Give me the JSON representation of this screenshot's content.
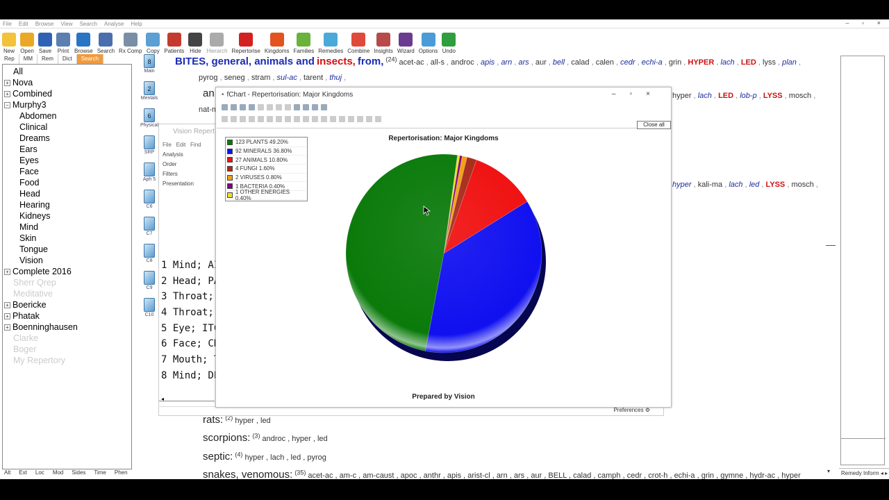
{
  "menu": [
    "File",
    "Edit",
    "Browse",
    "View",
    "Search",
    "Analyse",
    "Help"
  ],
  "toolbar": [
    {
      "label": "New",
      "icon": "new-icon",
      "color": "#f2c23a"
    },
    {
      "label": "Open",
      "icon": "folder-icon",
      "color": "#e9a826"
    },
    {
      "label": "Save",
      "icon": "save-icon",
      "color": "#2f62b5"
    },
    {
      "label": "Print",
      "icon": "print-icon",
      "color": "#5a7fb0"
    },
    {
      "label": "Browse",
      "icon": "book-icon",
      "color": "#2a74c4"
    },
    {
      "label": "Search",
      "icon": "magnifier-icon",
      "color": "#4b6fae"
    },
    {
      "label": "Rx Comp",
      "icon": "bottle-icon",
      "color": "#7a8fa5"
    },
    {
      "label": "Copy",
      "icon": "copy-icon",
      "color": "#5c9fd3"
    },
    {
      "label": "Patients",
      "icon": "calendar-icon",
      "color": "#c43a2e"
    },
    {
      "label": "Hide",
      "icon": "sphere-icon",
      "color": "#444"
    },
    {
      "label": "Hierarch",
      "icon": "hierarchy-icon",
      "color": "#aaa"
    },
    {
      "label": "Repertorise",
      "icon": "exclamation-icon",
      "color": "#d32020"
    },
    {
      "label": "Kingdoms",
      "icon": "pie-icon",
      "color": "#e2531f"
    },
    {
      "label": "Families",
      "icon": "families-icon",
      "color": "#6ab23b"
    },
    {
      "label": "Remedies",
      "icon": "remedies-icon",
      "color": "#4aa9d8"
    },
    {
      "label": "Combine",
      "icon": "combine-icon",
      "color": "#e04a3a"
    },
    {
      "label": "Insights",
      "icon": "insights-icon",
      "color": "#b94a4a"
    },
    {
      "label": "Wizard",
      "icon": "wizard-icon",
      "color": "#6b3b8f"
    },
    {
      "label": "Options",
      "icon": "options-icon",
      "color": "#4a9bd8"
    },
    {
      "label": "Undo",
      "icon": "undo-icon",
      "color": "#2e9e3e"
    }
  ],
  "left_tabs": [
    "Rep",
    "MM",
    "Rem",
    "Dict",
    "Search"
  ],
  "tree": [
    {
      "label": "All",
      "level": 0,
      "exp": "",
      "dim": false
    },
    {
      "label": "Nova",
      "level": 0,
      "exp": "+",
      "dim": false
    },
    {
      "label": "Combined",
      "level": 0,
      "exp": "+",
      "dim": false
    },
    {
      "label": "Murphy3",
      "level": 0,
      "exp": "−",
      "dim": false
    },
    {
      "label": "Abdomen",
      "level": 1,
      "exp": "",
      "dim": false
    },
    {
      "label": "Clinical",
      "level": 1,
      "exp": "",
      "dim": false
    },
    {
      "label": "Dreams",
      "level": 1,
      "exp": "",
      "dim": false
    },
    {
      "label": "Ears",
      "level": 1,
      "exp": "",
      "dim": false
    },
    {
      "label": "Eyes",
      "level": 1,
      "exp": "",
      "dim": false
    },
    {
      "label": "Face",
      "level": 1,
      "exp": "",
      "dim": false
    },
    {
      "label": "Food",
      "level": 1,
      "exp": "",
      "dim": false
    },
    {
      "label": "Head",
      "level": 1,
      "exp": "",
      "dim": false
    },
    {
      "label": "Hearing",
      "level": 1,
      "exp": "",
      "dim": false
    },
    {
      "label": "Kidneys",
      "level": 1,
      "exp": "",
      "dim": false
    },
    {
      "label": "Mind",
      "level": 1,
      "exp": "",
      "dim": false
    },
    {
      "label": "Skin",
      "level": 1,
      "exp": "",
      "dim": false
    },
    {
      "label": "Tongue",
      "level": 1,
      "exp": "",
      "dim": false
    },
    {
      "label": "Vision",
      "level": 1,
      "exp": "",
      "dim": false
    },
    {
      "label": "Complete 2016",
      "level": 0,
      "exp": "+",
      "dim": false
    },
    {
      "label": "Sherr Qrep",
      "level": 0,
      "exp": "",
      "dim": true
    },
    {
      "label": "Meditative",
      "level": 0,
      "exp": "",
      "dim": true
    },
    {
      "label": "Boericke",
      "level": 0,
      "exp": "+",
      "dim": false
    },
    {
      "label": "Phatak",
      "level": 0,
      "exp": "+",
      "dim": false
    },
    {
      "label": "Boenninghausen",
      "level": 0,
      "exp": "+",
      "dim": false
    },
    {
      "label": "Clarke",
      "level": 0,
      "exp": "",
      "dim": true
    },
    {
      "label": "Boger",
      "level": 0,
      "exp": "",
      "dim": true
    },
    {
      "label": "My Repertory",
      "level": 0,
      "exp": "",
      "dim": true
    }
  ],
  "bottom_tabs": [
    "Alt",
    "Ext",
    "Loc",
    "Mod",
    "Sides",
    "Time",
    "Phen"
  ],
  "chapters": [
    {
      "num": "8",
      "label": "Main"
    },
    {
      "num": "2",
      "label": "Mentals"
    },
    {
      "num": "6",
      "label": "Physical"
    },
    {
      "num": "",
      "label": "SRP"
    },
    {
      "num": "",
      "label": "Aph 5"
    },
    {
      "num": "",
      "label": "C6"
    },
    {
      "num": "",
      "label": "C7"
    },
    {
      "num": "",
      "label": "C8"
    },
    {
      "num": "",
      "label": "C9"
    },
    {
      "num": "",
      "label": "C10"
    }
  ],
  "main": {
    "title_a": "BITES, general, animals and",
    "title_b": "insects,",
    "title_c": "from,",
    "title_count": "(24)",
    "line1_remedies": [
      {
        "t": "acet-ac",
        "s": ""
      },
      {
        "t": "all-s",
        "s": ""
      },
      {
        "t": "androc",
        "s": ""
      },
      {
        "t": "apis",
        "s": "it"
      },
      {
        "t": "arn",
        "s": "it"
      },
      {
        "t": "ars",
        "s": "it"
      },
      {
        "t": "aur",
        "s": ""
      },
      {
        "t": "bell",
        "s": "it"
      },
      {
        "t": "calad",
        "s": ""
      },
      {
        "t": "calen",
        "s": ""
      },
      {
        "t": "cedr",
        "s": "it"
      },
      {
        "t": "echi-a",
        "s": "it"
      },
      {
        "t": "grin",
        "s": ""
      },
      {
        "t": "HYPER",
        "s": "bold"
      },
      {
        "t": "lach",
        "s": "it"
      },
      {
        "t": "LED",
        "s": "bold"
      },
      {
        "t": "lyss",
        "s": ""
      },
      {
        "t": "plan",
        "s": "it"
      }
    ],
    "line2_remedies": [
      {
        "t": "pyrog",
        "s": ""
      },
      {
        "t": "seneg",
        "s": ""
      },
      {
        "t": "stram",
        "s": ""
      },
      {
        "t": "sul-ac",
        "s": "it"
      },
      {
        "t": "tarent",
        "s": ""
      },
      {
        "t": "thuj",
        "s": "it"
      }
    ],
    "line3_start": "an",
    "line3_remedies": [
      {
        "t": "hyper",
        "s": ""
      },
      {
        "t": "lach",
        "s": "it"
      },
      {
        "t": "LED",
        "s": "bold"
      },
      {
        "t": "lob-p",
        "s": "it"
      },
      {
        "t": "LYSS",
        "s": "bold"
      },
      {
        "t": "mosch",
        "s": ""
      }
    ],
    "line4_start": "nat-m",
    "line5_remedies": [
      {
        "t": "hyper",
        "s": "it"
      },
      {
        "t": "kali-ma",
        "s": ""
      },
      {
        "t": "lach",
        "s": "it"
      },
      {
        "t": "led",
        "s": "it"
      },
      {
        "t": "LYSS",
        "s": "bold"
      },
      {
        "t": "mosch",
        "s": ""
      }
    ],
    "rats_label": "rats:",
    "rats_count": "(2)",
    "rats_remedies": "hyper , led",
    "scorpions_label": "scorpions:",
    "scorpions_count": "(3)",
    "scorpions_remedies": "androc , hyper , led",
    "septic_label": "septic:",
    "septic_count": "(4)",
    "septic_remedies": "hyper , lach , led , pyrog",
    "snakes_label": "snakes, venomous:",
    "snakes_count": "(35)",
    "snakes_remedies": "acet-ac , am-c , am-caust , apoc , anthr , apis , arist-cl , arn , ars , aur , BELL , calad , camph , cedr , crot-h , echi-a , grin , gymne , hydr-ac , hyper"
  },
  "vision_window": {
    "title": "Vision Repert",
    "menu": [
      "File",
      "Edit",
      "Find"
    ],
    "side_items": [
      "Analysis",
      "Order",
      "Filters",
      "Presentation"
    ],
    "symptoms": [
      "1 Mind; AI",
      "2 Head; PA",
      "3 Throat; I",
      "4 Throat; I",
      "5 Eye; ITC",
      "6 Face; CR",
      "7 Mouth; T",
      "8 Mind; DE"
    ],
    "preferences": "Preferences"
  },
  "right_bottom": "Remedy Inform",
  "fchart": {
    "title": "fChart - Repertorisation: Major Kingdoms",
    "close_all": "Close all"
  },
  "chart_data": {
    "type": "pie",
    "title": "Repertorisation: Major Kingdoms",
    "footer": "Prepared by Vision",
    "legend_position": "top-left",
    "slices": [
      {
        "label": "123 PLANTS 49.20%",
        "value": 123,
        "percent": 49.2,
        "color": "#0a7a0a"
      },
      {
        "label": "92 MINERALS 36.80%",
        "value": 92,
        "percent": 36.8,
        "color": "#1010f0"
      },
      {
        "label": "27 ANIMALS 10.80%",
        "value": 27,
        "percent": 10.8,
        "color": "#f01010"
      },
      {
        "label": "4 FUNGI 1.60%",
        "value": 4,
        "percent": 1.6,
        "color": "#a82a1a"
      },
      {
        "label": "2 VIRUSES 0.80%",
        "value": 2,
        "percent": 0.8,
        "color": "#f0a010"
      },
      {
        "label": "1 BACTERIA 0.40%",
        "value": 1,
        "percent": 0.4,
        "color": "#800080"
      },
      {
        "label": "1 OTHER ENERGIES 0.40%",
        "value": 1,
        "percent": 0.4,
        "color": "#f0e020"
      }
    ]
  }
}
